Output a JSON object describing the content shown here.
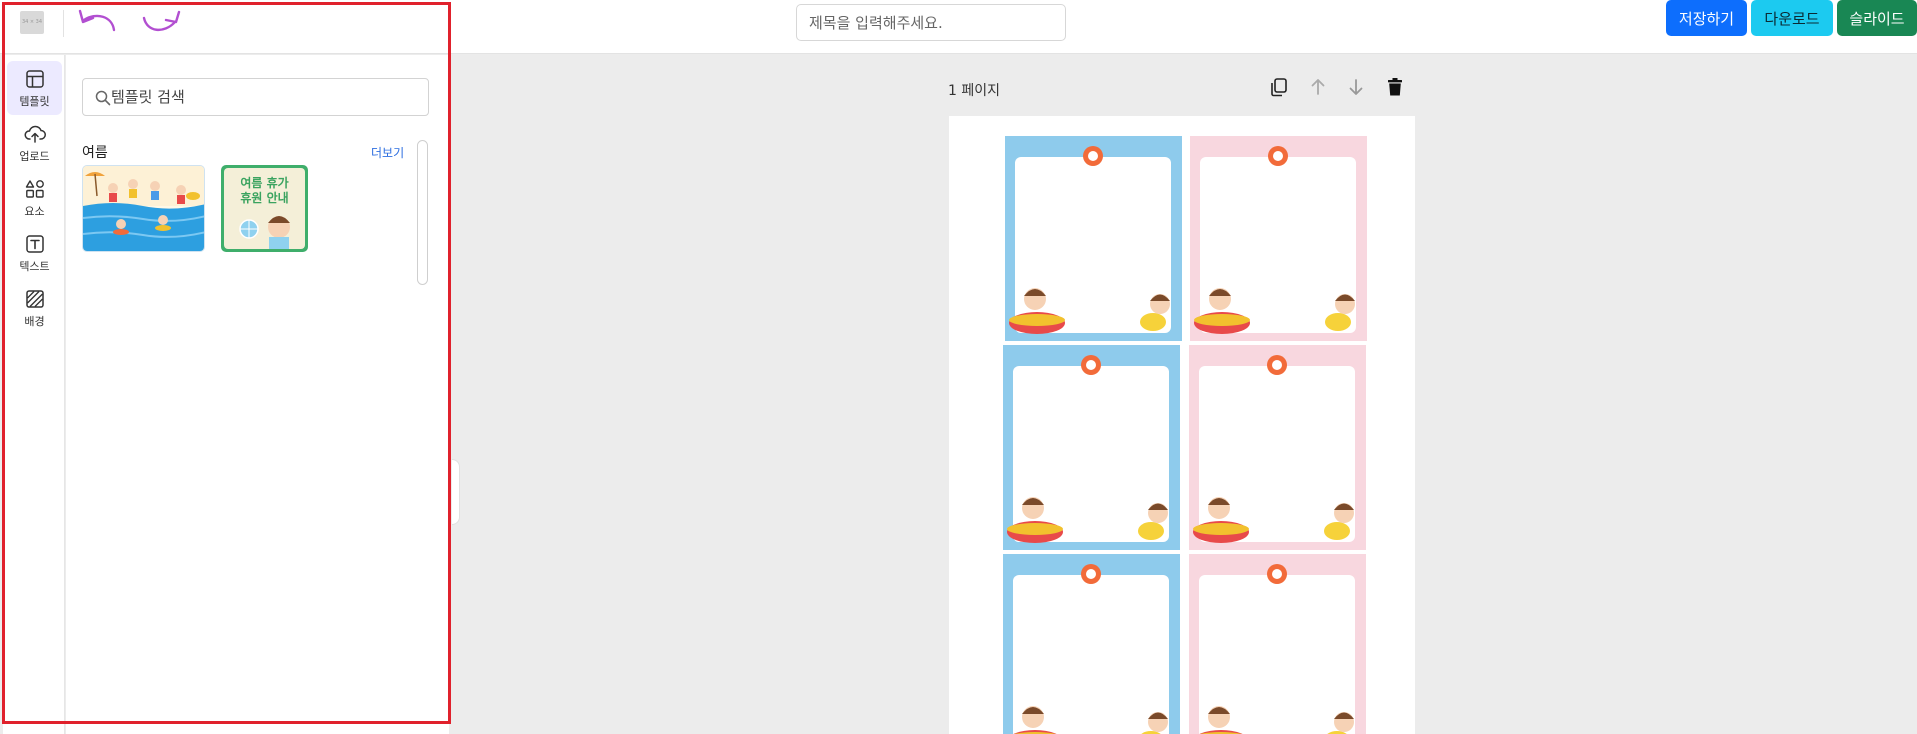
{
  "header": {
    "logo_text": "34 × 34",
    "title_placeholder": "제목을 입력해주세요.",
    "buttons": {
      "save": "저장하기",
      "download": "다운로드",
      "slide": "슬라이드"
    }
  },
  "sidebar": {
    "items": [
      {
        "label": "템플릿",
        "icon": "layout-template-icon",
        "active": true
      },
      {
        "label": "업로드",
        "icon": "cloud-upload-icon"
      },
      {
        "label": "요소",
        "icon": "shapes-icon"
      },
      {
        "label": "텍스트",
        "icon": "text-box-icon"
      },
      {
        "label": "배경",
        "icon": "background-pattern-icon"
      }
    ]
  },
  "panel": {
    "search_placeholder": "템플릿 검색",
    "section_title": "여름",
    "more_label": "더보기",
    "templates": [
      {
        "name": "summer-beach-template"
      },
      {
        "name": "summer-vacation-notice-template",
        "text_line1": "여름 휴가",
        "text_line2": "휴원 안내"
      }
    ]
  },
  "canvas": {
    "page_label": "1 페이지",
    "cards": [
      {
        "color": "blue"
      },
      {
        "color": "pink"
      },
      {
        "color": "blue"
      },
      {
        "color": "pink"
      },
      {
        "color": "blue"
      },
      {
        "color": "pink"
      }
    ]
  },
  "colors": {
    "primary": "#0d6efd",
    "info": "#1ccaf0",
    "success": "#198754",
    "highlight": "#e0212c",
    "card_blue": "#8ecbec",
    "card_pink": "#f8d7df",
    "undo_redo": "#b24fd1"
  }
}
